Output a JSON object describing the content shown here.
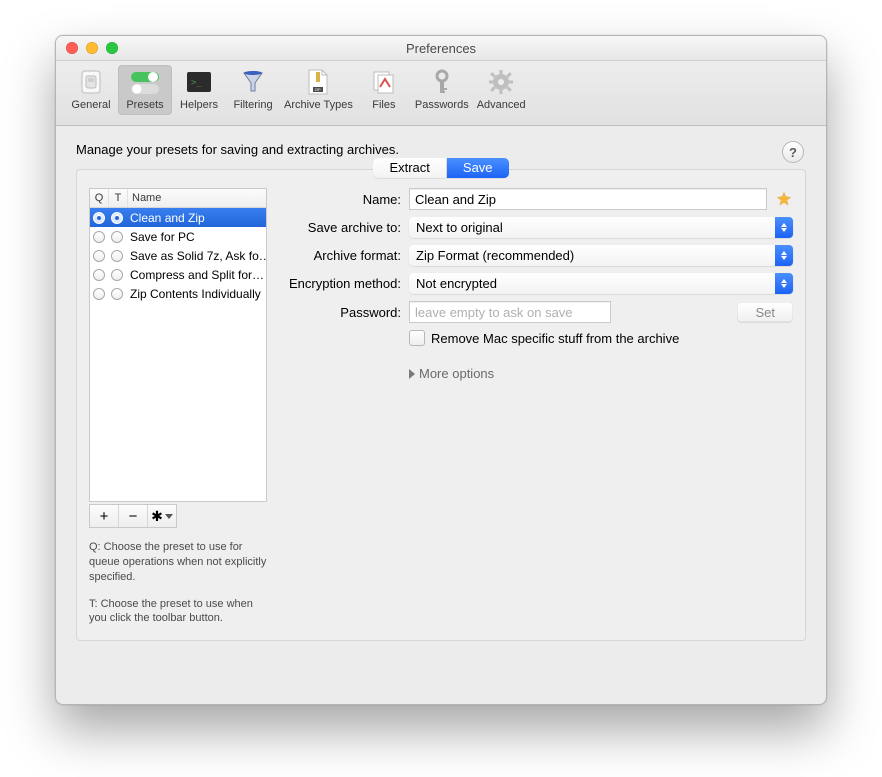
{
  "window": {
    "title": "Preferences"
  },
  "toolbar": {
    "items": [
      {
        "label": "General"
      },
      {
        "label": "Presets",
        "selected": true
      },
      {
        "label": "Helpers"
      },
      {
        "label": "Filtering"
      },
      {
        "label": "Archive Types"
      },
      {
        "label": "Files"
      },
      {
        "label": "Passwords"
      },
      {
        "label": "Advanced"
      }
    ]
  },
  "main": {
    "headline": "Manage your presets for saving and extracting archives.",
    "tabs": [
      "Extract",
      "Save"
    ],
    "active_tab": "Save"
  },
  "list": {
    "columns": [
      "Q",
      "T",
      "Name"
    ],
    "rows": [
      {
        "q": true,
        "t": true,
        "name": "Clean and Zip",
        "selected": true
      },
      {
        "q": false,
        "t": false,
        "name": "Save for PC"
      },
      {
        "q": false,
        "t": false,
        "name": "Save as Solid 7z, Ask fo…"
      },
      {
        "q": false,
        "t": false,
        "name": "Compress and Split for…"
      },
      {
        "q": false,
        "t": false,
        "name": "Zip Contents Individually"
      }
    ],
    "hint_q": "Q: Choose the preset to use for queue operations when not explicitly specified.",
    "hint_t": "T: Choose the preset to use when you click the toolbar button."
  },
  "form": {
    "labels": {
      "name": "Name:",
      "save_to": "Save archive to:",
      "format": "Archive format:",
      "encryption": "Encryption method:",
      "password": "Password:"
    },
    "values": {
      "name": "Clean and Zip",
      "save_to": "Next to original",
      "format": "Zip Format (recommended)",
      "encryption": "Not encrypted",
      "password_placeholder": "leave empty to ask on save"
    },
    "set_button": "Set",
    "remove_mac_label": "Remove Mac specific stuff from the archive",
    "more_options": "More options"
  }
}
